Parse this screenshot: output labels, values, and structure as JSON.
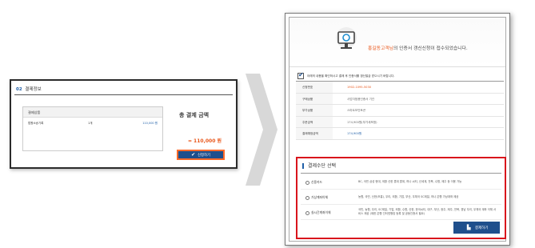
{
  "left": {
    "section_num": "02",
    "section_title": "결제정보",
    "box_header": "결제상품",
    "row": {
      "name": "법원소송기록",
      "qty": "1개",
      "price": "110,000 원"
    },
    "total_label": "총 결제 금액",
    "total_price": "= 110,000 원",
    "apply_button": "신청하기"
  },
  "right": {
    "message_name": "홍길동고객님",
    "message_rest": "의 인증서 갱신신청이 접수되었습니다.",
    "notice": "아래의 내용을 확인하시고 결제 후 인증서를 갱신발급 받으시기 바랍니다.",
    "info": [
      {
        "key": "신청번호",
        "value": "1902-1095-5030",
        "style": "orange"
      },
      {
        "key": "구매상품",
        "value": "사업자범용인증서 기관",
        "style": ""
      },
      {
        "key": "부가상품",
        "value": "스마트보안토큰",
        "style": ""
      },
      {
        "key": "주문금액",
        "value": "174,900원(부가세포함)",
        "style": ""
      },
      {
        "key": "결제예정금액",
        "value": "174,900원",
        "style": "blue"
      }
    ],
    "payment": {
      "title": "결제수단 선택",
      "options": [
        {
          "label": "신용카드",
          "desc": "BC, 국민 삼성 현대, 외환 신한 롯데 롯데, 하나 씨티, 신세계, 전북, 수협, 제주 등 이용 가능"
        },
        {
          "label": "가상계좌이체",
          "desc": "농협, 국민, 신한(조흥), 우리, 외환, 기업, 부산, 우체국 SC제일, 하나 은행 가상계좌 제공"
        },
        {
          "label": "실시간계좌이체",
          "desc": "국민, 농협, 우리, SC제일, 기업, 외환, 수협, 신한, 한국씨티, 대구, 부산, 광주, 제주, 전북, 경남 우리, 우체국 계좌 이체 서비스 제공 (제한 은행 인터넷뱅킹 등록 및 공동인증서 필요)"
        }
      ],
      "button": "결제하기"
    }
  }
}
